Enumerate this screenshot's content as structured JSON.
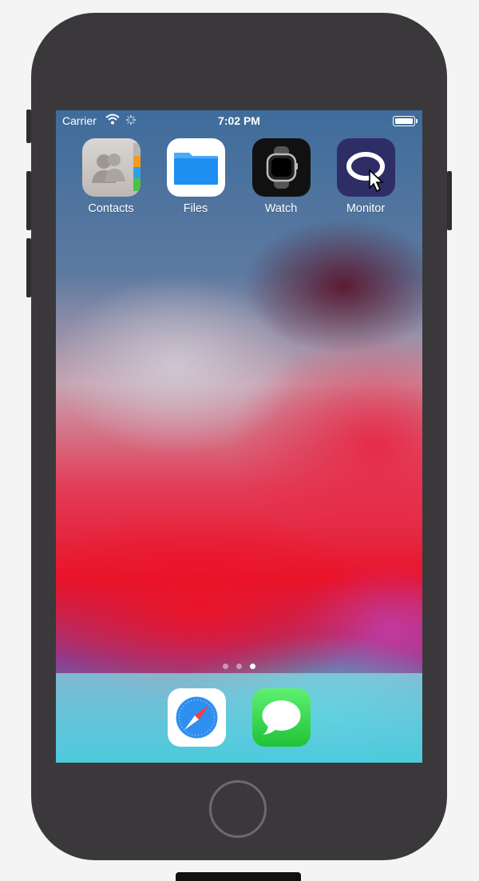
{
  "status_bar": {
    "carrier": "Carrier",
    "time": "7:02 PM",
    "icons": [
      "wifi-icon",
      "activity-spinner-icon",
      "battery-icon"
    ]
  },
  "home_screen": {
    "apps": [
      {
        "label": "Contacts",
        "icon": "contacts-icon"
      },
      {
        "label": "Files",
        "icon": "files-folder-icon"
      },
      {
        "label": "Watch",
        "icon": "watch-icon"
      },
      {
        "label": "Monitor",
        "icon": "monitor-ring-icon"
      }
    ],
    "page_indicator": {
      "pages": 3,
      "current_page": 3
    }
  },
  "dock": {
    "apps": [
      {
        "icon": "safari-compass-icon"
      },
      {
        "icon": "messages-bubble-icon"
      }
    ]
  },
  "colors": {
    "device_body": "#3a383b",
    "files_blue": "#1e8ff2",
    "monitor_bg": "#2f2d66",
    "messages_green": "#2fd14a"
  }
}
